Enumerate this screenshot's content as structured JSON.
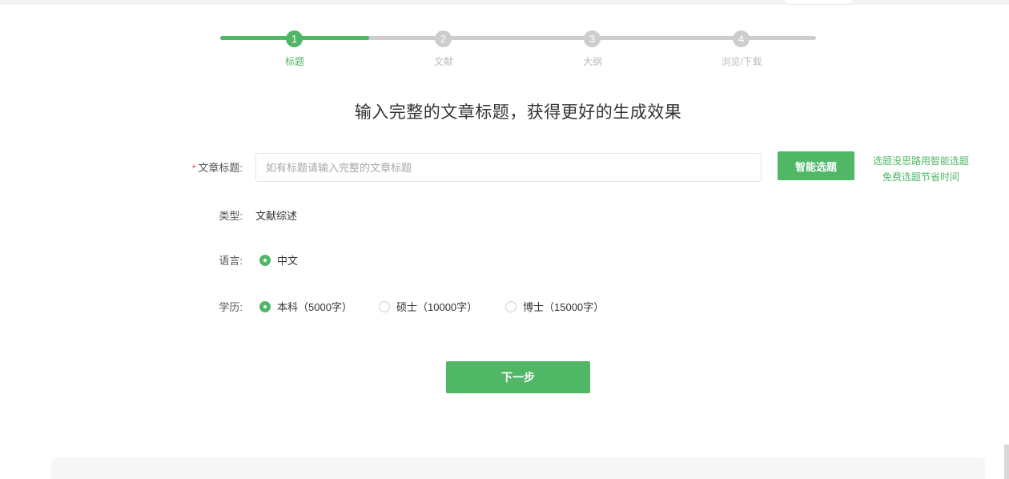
{
  "stepper": {
    "steps": [
      {
        "number": "1",
        "label": "标题"
      },
      {
        "number": "2",
        "label": "文献"
      },
      {
        "number": "3",
        "label": "大纲"
      },
      {
        "number": "4",
        "label": "浏览/下载"
      }
    ],
    "current_step": 1
  },
  "headline": "输入完整的文章标题，获得更好的生成效果",
  "form": {
    "title": {
      "required_mark": "*",
      "label": "文章标题:",
      "placeholder": "如有标题请输入完整的文章标题",
      "value": ""
    },
    "smart_button": "智能选题",
    "hint_lines": [
      "选题没思路用智能选题",
      "免费选题节省时间"
    ],
    "type": {
      "label": "类型:",
      "value": "文献综述"
    },
    "language": {
      "label": "语言:",
      "options": [
        {
          "text": "中文",
          "checked": true
        }
      ]
    },
    "degree": {
      "label": "学历:",
      "options": [
        {
          "text": "本科（5000字）",
          "checked": true
        },
        {
          "text": "硕士（10000字）",
          "checked": false
        },
        {
          "text": "博士（15000字）",
          "checked": false
        }
      ]
    }
  },
  "next_button": "下一步",
  "colors": {
    "accent": "#4fb766",
    "inactive": "#cdcdcd"
  }
}
